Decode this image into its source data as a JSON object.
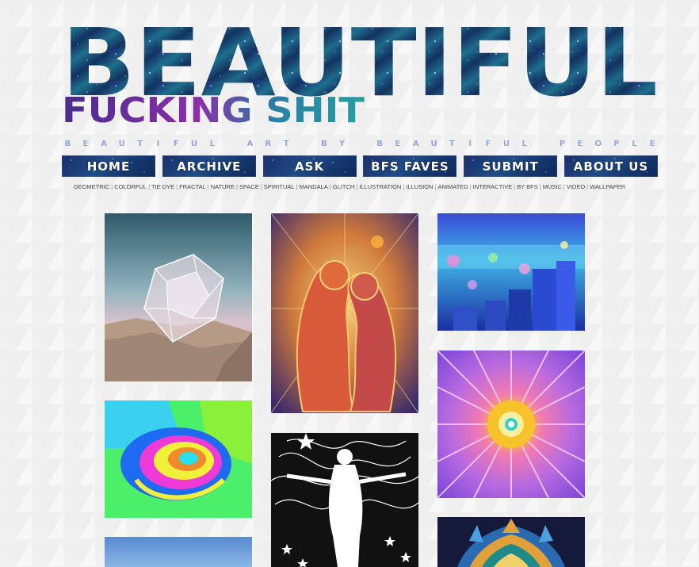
{
  "header": {
    "title_main": "BEAUTIFUL",
    "title_sub": "FUCKING SHIT",
    "tagline_words": [
      "BEAUTIFUL",
      "ART",
      "BY",
      "BEAUTIFUL",
      "PEOPLE"
    ]
  },
  "nav": [
    {
      "label": "HOME"
    },
    {
      "label": "ARCHIVE"
    },
    {
      "label": "ASK"
    },
    {
      "label": "BFS FAVES"
    },
    {
      "label": "SUBMIT"
    },
    {
      "label": "ABOUT US"
    }
  ],
  "tags": [
    "GEOMETRIC",
    "COLORFUL",
    "TIE DYE",
    "FRACTAL",
    "NATURE",
    "SPACE",
    "SPIRITUAL",
    "MANDALA",
    "GLITCH",
    "ILLUSTRATION",
    "ILLUSION",
    "ANIMATED",
    "INTERACTIVE",
    "BY BFS",
    "MUSIC",
    "VIDEO",
    "WALLPAPER"
  ],
  "posts": [
    {
      "subject": "geometric-desert"
    },
    {
      "subject": "spiritual-couple"
    },
    {
      "subject": "anime-city"
    },
    {
      "subject": "tie-dye-spiral"
    },
    {
      "subject": "mandala-burst"
    },
    {
      "subject": "line-art-woman"
    },
    {
      "subject": "sky"
    },
    {
      "subject": "lotus-mandala"
    }
  ],
  "colors": {
    "space_dark": "#16225a",
    "space_teal": "#1b6e86",
    "sub_purple": "#6a2a9a",
    "sub_teal": "#1f9aa6",
    "tagline": "#5ba6d8"
  }
}
